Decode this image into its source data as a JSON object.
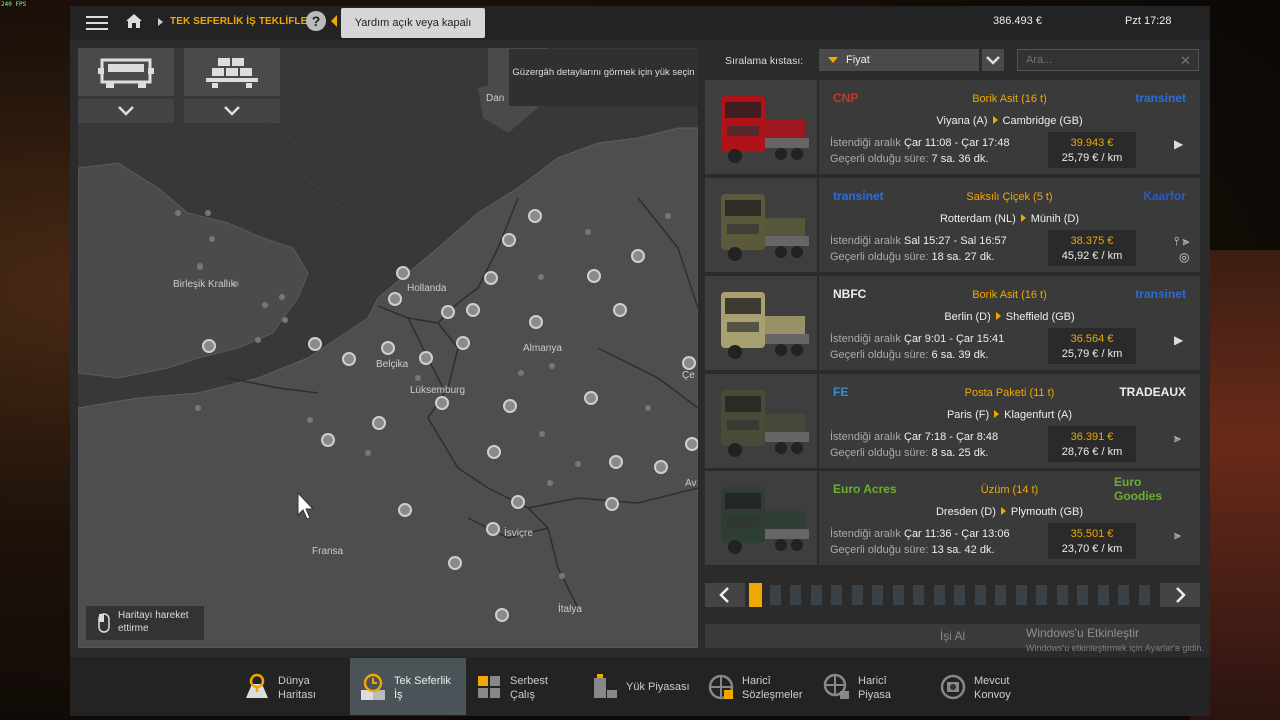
{
  "hud": {
    "fps": "240 FPS"
  },
  "topbar": {
    "breadcrumb": "TEK SEFERLİK İŞ TEKLİFLERİ",
    "help_button": "?",
    "help_tooltip": "Yardım açık veya kapalı",
    "money": "386.493 €",
    "clock": "Pzt 17:28"
  },
  "map": {
    "tooltip": "Güzergâh detaylarını görmek için yük seçin",
    "labels": {
      "uk": "Birleşik Krallık",
      "nl": "Hollanda",
      "be": "Belçika",
      "lu": "Lüksemburg",
      "de": "Almanya",
      "fr": "Fransa",
      "ch": "İsviçre",
      "it": "İtalya",
      "dan": "Dan",
      "cek": "Çe",
      "av": "Av"
    },
    "move_hint": "Haritayı hareket ettirme"
  },
  "sort": {
    "label": "Sıralama kıstası:",
    "value": "Fiyat",
    "search_placeholder": "Ara..."
  },
  "jobs": [
    {
      "from_logo": "CNP",
      "cargo": "Borik Asit (16 t)",
      "to_logo": "transinet",
      "from": "Viyana (A)",
      "to": "Cambridge (GB)",
      "range_label": "İstendiği aralık",
      "range": "Çar 11:08 - Çar 17:48",
      "valid_label": "Geçerli olduğu süre:",
      "valid": "7 sa. 36 dk.",
      "price": "39.943 €",
      "per_km": "25,79 € / km",
      "truck_color": "#b0121a"
    },
    {
      "from_logo": "transinet",
      "cargo": "Saksılı Çiçek (5 t)",
      "to_logo": "Kaarfor",
      "from": "Rotterdam (NL)",
      "to": "Münih (D)",
      "range_label": "İstendiği aralık",
      "range": "Sal 15:27 - Sal 16:57",
      "valid_label": "Geçerli olduğu süre:",
      "valid": "18 sa. 27 dk.",
      "price": "38.375 €",
      "per_km": "45,92 € / km",
      "truck_color": "#5a5a3a"
    },
    {
      "from_logo": "NBFC",
      "cargo": "Borik Asit (16 t)",
      "to_logo": "transinet",
      "from": "Berlin (D)",
      "to": "Sheffield (GB)",
      "range_label": "İstendiği aralık",
      "range": "Çar 9:01 - Çar 15:41",
      "valid_label": "Geçerli olduğu süre:",
      "valid": "6 sa. 39 dk.",
      "price": "36.564 €",
      "per_km": "25,79 € / km",
      "truck_color": "#a8a070"
    },
    {
      "from_logo": "FE",
      "cargo": "Posta Paketi (11 t)",
      "to_logo": "TRADEAUX",
      "from": "Paris (F)",
      "to": "Klagenfurt (A)",
      "range_label": "İstendiği aralık",
      "range": "Çar 7:18 - Çar 8:48",
      "valid_label": "Geçerli olduğu süre:",
      "valid": "8 sa. 25 dk.",
      "price": "36.391 €",
      "per_km": "28,76 € / km",
      "truck_color": "#4a4a38"
    },
    {
      "from_logo": "Euro Acres",
      "cargo": "Üzüm (14 t)",
      "to_logo": "Euro Goodies",
      "from": "Dresden (D)",
      "to": "Plymouth (GB)",
      "range_label": "İstendiği aralık",
      "range": "Çar 11:36 - Çar 13:06",
      "valid_label": "Geçerli olduğu süre:",
      "valid": "13 sa. 42 dk.",
      "price": "35.501 €",
      "per_km": "23,70 € / km",
      "truck_color": "#2e3e34"
    }
  ],
  "pager": {
    "total_pages": 20,
    "current_page": 1
  },
  "take_job": "İşi Al",
  "watermark": {
    "title": "Windows'u Etkinleştir",
    "subtitle": "Windows'u etkinleştirmek için Ayarlar'a gidin."
  },
  "tabs": [
    {
      "line1": "Dünya",
      "line2": "Haritası",
      "icon": "world-map-icon"
    },
    {
      "line1": "Tek Seferlik",
      "line2": "İş",
      "icon": "clock-icon",
      "active": true
    },
    {
      "line1": "Serbest",
      "line2": "Çalış",
      "icon": "boxes-icon"
    },
    {
      "line1": "Yük Piyasası",
      "line2": "",
      "icon": "cargo-icon"
    },
    {
      "line1": "Haricî",
      "line2": "Sözleşmeler",
      "icon": "globe-contract-icon"
    },
    {
      "line1": "Haricî",
      "line2": "Piyasa",
      "icon": "globe-market-icon"
    },
    {
      "line1": "Mevcut",
      "line2": "Konvoy",
      "icon": "convoy-icon"
    }
  ],
  "colors": {
    "accent": "#f0a800",
    "panel": "#3a3a3a",
    "active_tab": "#4a5358"
  }
}
